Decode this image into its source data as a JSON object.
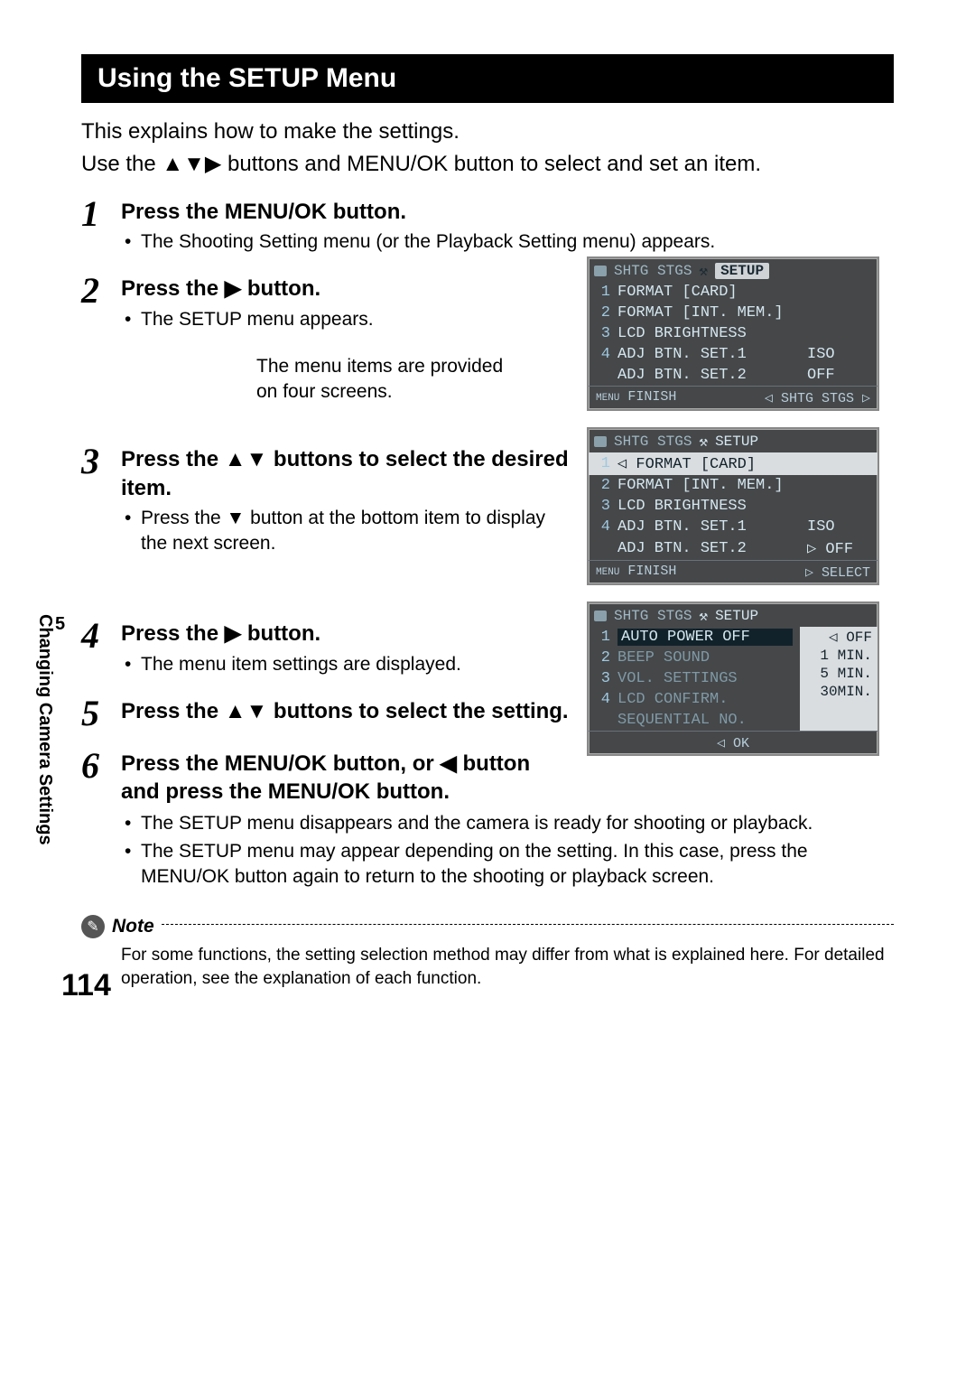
{
  "page_number": "114",
  "sidebar": {
    "chapter": "5",
    "title": "Changing Camera Settings"
  },
  "header": {
    "title": "Using the SETUP Menu"
  },
  "intro": {
    "l1": "This explains how to make the settings.",
    "l2a": "Use the ",
    "l2b": " buttons and MENU/OK button to select and set an item."
  },
  "steps": {
    "s1": {
      "title": "Press the MENU/OK button.",
      "b1": "The Shooting Setting menu (or the Playback Setting menu) appears."
    },
    "s2": {
      "title_a": "Press the ",
      "title_b": " button.",
      "b1": "The SETUP menu appears.",
      "sub": "The menu items are provided on four screens."
    },
    "s3": {
      "title_a": "Press the ",
      "title_b": " buttons to select the desired item.",
      "b1_a": "Press the ",
      "b1_b": " button at the bottom item to display the next screen."
    },
    "s4": {
      "title_a": "Press the ",
      "title_b": " button.",
      "b1": "The menu item settings are displayed."
    },
    "s5": {
      "title_a": "Press the ",
      "title_b": " buttons to select the setting."
    },
    "s6": {
      "title_a": "Press the MENU/OK button, or ",
      "title_b": " button and press the MENU/OK button.",
      "b1": "The SETUP menu disappears and the camera is ready for shooting or playback.",
      "b2": "The SETUP menu may appear depending on the setting. In this case, press the MENU/OK button again to return to the shooting or playback screen."
    }
  },
  "note": {
    "label": "Note",
    "text": "For some functions, the setting selection method may differ from what is explained here. For detailed operation, see the explanation of each function."
  },
  "lcd1": {
    "tab_left": "SHTG STGS",
    "tab_right": "SETUP",
    "rows": [
      {
        "i": "1",
        "l": "FORMAT [CARD]",
        "v": ""
      },
      {
        "i": "2",
        "l": "FORMAT [INT. MEM.]",
        "v": ""
      },
      {
        "i": "3",
        "l": "LCD BRIGHTNESS",
        "v": ""
      },
      {
        "i": "4",
        "l": "ADJ BTN. SET.1",
        "v": "ISO"
      },
      {
        "i": "",
        "l": "ADJ BTN. SET.2",
        "v": "OFF"
      }
    ],
    "foot_l": "FINISH",
    "foot_r": "◁ SHTG STGS ▷"
  },
  "lcd2": {
    "tab_left": "SHTG STGS",
    "tab_right": "SETUP",
    "rows": [
      {
        "i": "1",
        "l": "FORMAT [CARD]",
        "v": "",
        "sel": true,
        "pre": "◁"
      },
      {
        "i": "2",
        "l": "FORMAT [INT. MEM.]",
        "v": ""
      },
      {
        "i": "3",
        "l": "LCD BRIGHTNESS",
        "v": ""
      },
      {
        "i": "4",
        "l": "ADJ BTN. SET.1",
        "v": "ISO"
      },
      {
        "i": "",
        "l": "ADJ BTN. SET.2",
        "v": "▷ OFF"
      }
    ],
    "foot_l": "FINISH",
    "foot_r": "▷ SELECT"
  },
  "lcd3": {
    "tab_left": "SHTG STGS",
    "tab_right": "SETUP",
    "rows": [
      {
        "i": "1",
        "l": "AUTO POWER OFF",
        "sel": true
      },
      {
        "i": "2",
        "l": "BEEP SOUND"
      },
      {
        "i": "3",
        "l": "VOL. SETTINGS"
      },
      {
        "i": "4",
        "l": "LCD CONFIRM."
      },
      {
        "i": "",
        "l": "SEQUENTIAL NO."
      }
    ],
    "opts": [
      "◁ OFF",
      "1 MIN.",
      "5 MIN.",
      "30MIN."
    ],
    "foot": "◁ OK"
  }
}
